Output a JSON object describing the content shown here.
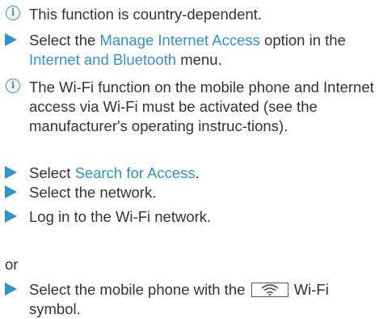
{
  "notes": {
    "country": "This function is country-dependent.",
    "wifi_prereq": "The Wi-Fi function on the mobile phone and Internet access via Wi-Fi must be activated (see the manufacturer's operating instruc-tions)."
  },
  "steps": {
    "manage_prefix": "Select the ",
    "manage_link": "Manage Internet Access",
    "manage_middle": " option in the ",
    "manage_link2": "Internet and Bluetooth",
    "manage_suffix": " menu.",
    "search_prefix": "Select ",
    "search_link": "Search for Access",
    "search_suffix": ".",
    "network": "Select the network.",
    "login": "Log in to the Wi-Fi network.",
    "or": "or",
    "phone_prefix": "Select the mobile phone with the",
    "phone_suffix": "Wi-Fi symbol."
  },
  "icons": {
    "info": "info-icon",
    "step": "step-arrow-icon",
    "wifi": "wifi-symbol-icon"
  },
  "colors": {
    "accent": "#2f94c9",
    "text": "#333333"
  }
}
